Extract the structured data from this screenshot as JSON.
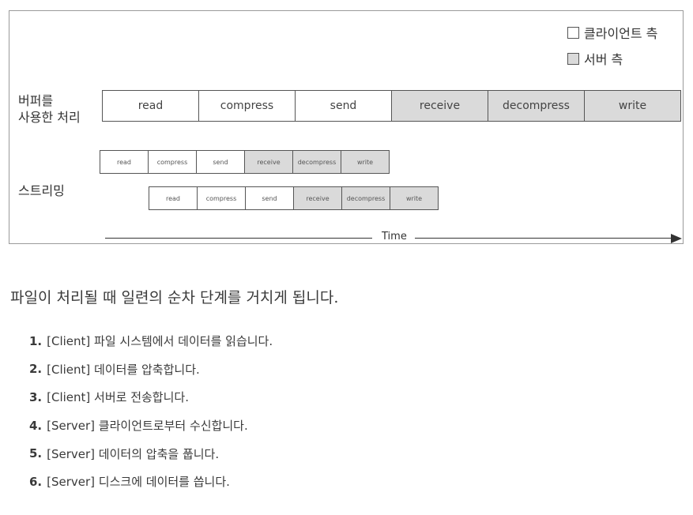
{
  "legend": {
    "client_label": "클라이언트 측",
    "server_label": "서버 측",
    "client_color": "#ffffff",
    "server_color": "#dadada"
  },
  "labels": {
    "buffered_line1": "버퍼를",
    "buffered_line2": "사용한 처리",
    "streaming": "스트리밍",
    "time": "Time"
  },
  "buffered_steps": [
    {
      "label": "read",
      "side": "client"
    },
    {
      "label": "compress",
      "side": "client"
    },
    {
      "label": "send",
      "side": "client"
    },
    {
      "label": "receive",
      "side": "server"
    },
    {
      "label": "decompress",
      "side": "server"
    },
    {
      "label": "write",
      "side": "server"
    }
  ],
  "streaming_row1": [
    {
      "label": "read",
      "side": "client"
    },
    {
      "label": "compress",
      "side": "client"
    },
    {
      "label": "send",
      "side": "client"
    },
    {
      "label": "receive",
      "side": "server"
    },
    {
      "label": "decompress",
      "side": "server"
    },
    {
      "label": "write",
      "side": "server"
    }
  ],
  "streaming_row2": [
    {
      "label": "read",
      "side": "client"
    },
    {
      "label": "compress",
      "side": "client"
    },
    {
      "label": "send",
      "side": "client"
    },
    {
      "label": "receive",
      "side": "server"
    },
    {
      "label": "decompress",
      "side": "server"
    },
    {
      "label": "write",
      "side": "server"
    }
  ],
  "intro": "파일이 처리될 때 일련의 순차 단계를 거치게 됩니다.",
  "steps": [
    {
      "num": "1.",
      "text": "[Client] 파일 시스템에서 데이터를 읽습니다."
    },
    {
      "num": "2.",
      "text": "[Client] 데이터를 압축합니다."
    },
    {
      "num": "3.",
      "text": "[Client] 서버로 전송합니다."
    },
    {
      "num": "4.",
      "text": "[Server] 클라이언트로부터 수신합니다."
    },
    {
      "num": "5.",
      "text": "[Server] 데이터의 압축을 풉니다."
    },
    {
      "num": "6.",
      "text": "[Server] 디스크에 데이터를 씁니다."
    }
  ]
}
